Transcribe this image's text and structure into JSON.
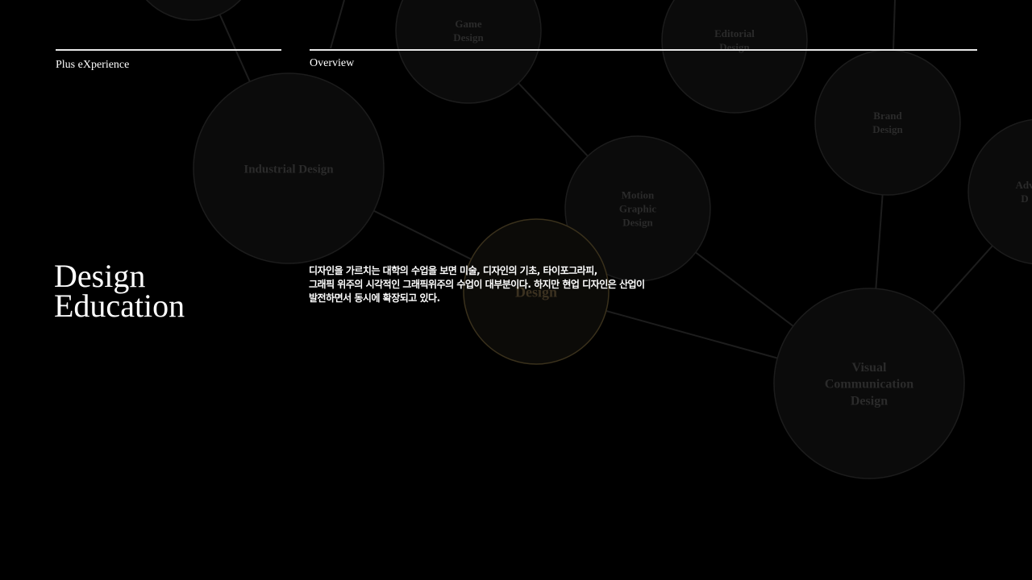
{
  "header": {
    "left_label": "Plus eXperience",
    "right_label": "Overview"
  },
  "headline": {
    "line1": "Design",
    "line2": "Education"
  },
  "body": {
    "lines": [
      "디자인을 가르치는 대학의 수업을 보면 미술, 디자인의 기초, 타이포그라피,",
      "그래픽 위주의 시각적인 그래픽위주의 수업이 대부분이다. 하지만 현업 디자인은 산업이",
      "발전하면서 동시에 확장되고 있다."
    ]
  },
  "network": {
    "nodes": [
      {
        "id": "top-left",
        "lines": []
      },
      {
        "id": "game",
        "lines": [
          "Game",
          "Design"
        ]
      },
      {
        "id": "editorial",
        "lines": [
          "Editorial",
          "Design"
        ]
      },
      {
        "id": "brand",
        "lines": [
          "Brand",
          "Design"
        ]
      },
      {
        "id": "advertising",
        "lines": [
          "Adv",
          "D"
        ]
      },
      {
        "id": "industrial",
        "lines": [
          "Industrial Design"
        ]
      },
      {
        "id": "motion",
        "lines": [
          "Motion",
          "Graphic",
          "Design"
        ]
      },
      {
        "id": "center",
        "lines": [
          "Design"
        ],
        "focus": true
      },
      {
        "id": "visual",
        "lines": [
          "Visual",
          "Communication",
          "Design"
        ]
      }
    ]
  }
}
